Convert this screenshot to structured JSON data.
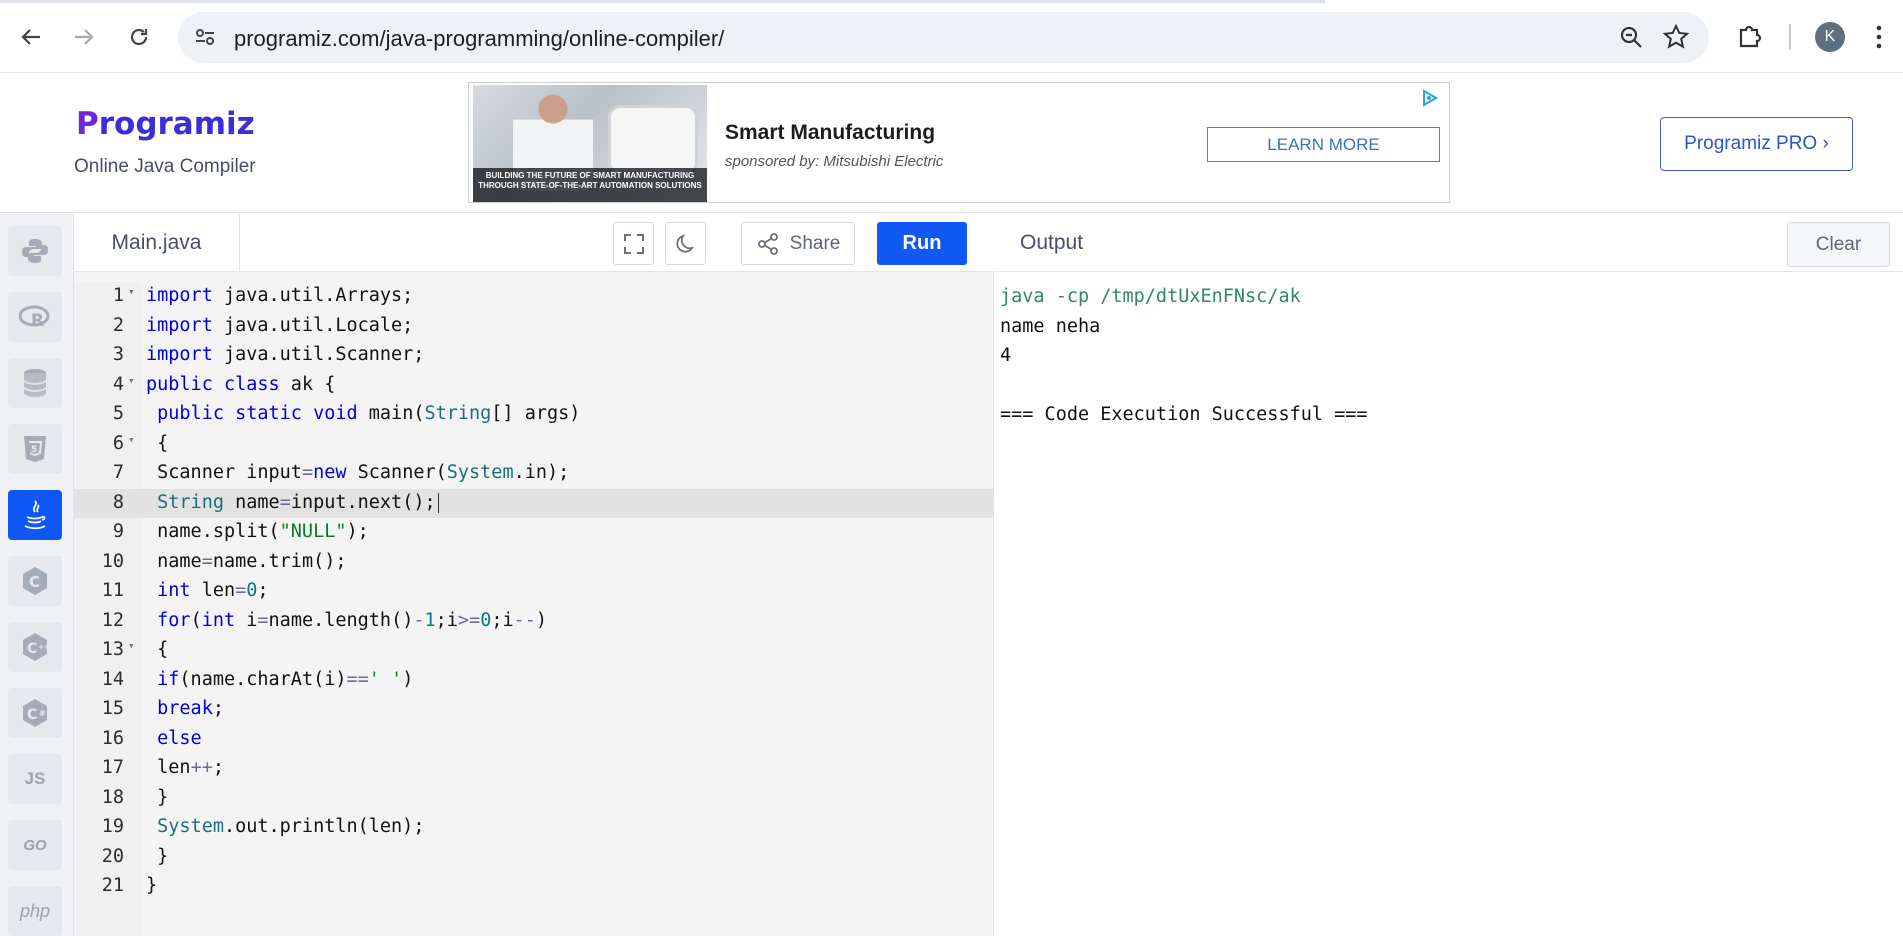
{
  "browser": {
    "url": "programiz.com/java-programming/online-compiler/",
    "profile_initial": "K"
  },
  "header": {
    "logo_text": "rogramiz",
    "logo_first_letter": "P",
    "subtitle": "Online Java Compiler",
    "pro_button": "Programiz PRO ›"
  },
  "ad": {
    "title": "Smart Manufacturing",
    "sponsor": "sponsored by: Mitsubishi Electric",
    "cta": "LEARN MORE",
    "image_caption": "BUILDING THE FUTURE OF SMART MANUFACTURING THROUGH STATE-OF-THE-ART AUTOMATION SOLUTIONS"
  },
  "rail": {
    "items": [
      "python-icon",
      "r-icon",
      "sql-icon",
      "html5-icon",
      "java-icon",
      "c-icon",
      "cpp-icon",
      "csharp-icon",
      "JS",
      "GO",
      "php"
    ],
    "active": "java-icon"
  },
  "editor": {
    "filename": "Main.java",
    "share_label": "Share",
    "run_label": "Run",
    "active_line": 8,
    "line_numbers": [
      "1",
      "2",
      "3",
      "4",
      "5",
      "6",
      "7",
      "8",
      "9",
      "10",
      "11",
      "12",
      "13",
      "14",
      "15",
      "16",
      "17",
      "18",
      "19",
      "20",
      "21"
    ],
    "lines": [
      "import java.util.Arrays;",
      "import java.util.Locale;",
      "import java.util.Scanner;",
      "public class ak {",
      " public static void main(String[] args)",
      " {",
      " Scanner input=new Scanner(System.in);",
      " String name=input.next();",
      " name.split(\"NULL\");",
      " name=name.trim();",
      " int len=0;",
      " for(int i=name.length()-1;i>=0;i--)",
      " {",
      " if(name.charAt(i)==' ')",
      " break;",
      " else",
      " len++;",
      " }",
      " System.out.println(len);",
      " }",
      "}"
    ]
  },
  "output": {
    "title": "Output",
    "clear_label": "Clear",
    "lines": [
      "java -cp /tmp/dtUxEnFNsc/ak",
      "name neha",
      "4",
      "",
      "=== Code Execution Successful ==="
    ]
  },
  "colors": {
    "accent": "#1158f4",
    "keyword": "#0000d6",
    "string": "#0a7b29",
    "type": "#1a6e7a"
  }
}
